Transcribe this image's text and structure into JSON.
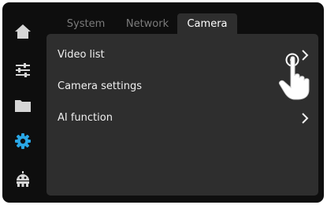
{
  "sidebar": {
    "items": [
      {
        "name": "home",
        "icon": "home-icon",
        "active": false
      },
      {
        "name": "adjustments",
        "icon": "sliders-icon",
        "active": false
      },
      {
        "name": "files",
        "icon": "folder-icon",
        "active": false
      },
      {
        "name": "settings",
        "icon": "gear-icon",
        "active": true
      },
      {
        "name": "robot",
        "icon": "robot-icon",
        "active": false
      }
    ]
  },
  "tabs": [
    {
      "label": "System",
      "active": false
    },
    {
      "label": "Network",
      "active": false
    },
    {
      "label": "Camera",
      "active": true
    }
  ],
  "menu": {
    "items": [
      {
        "label": "Video list",
        "has_chevron": true
      },
      {
        "label": "Camera settings",
        "has_chevron": false
      },
      {
        "label": "AI function",
        "has_chevron": true
      }
    ]
  },
  "colors": {
    "background": "#0e0e0e",
    "panel": "#2e2e2e",
    "icon": "#d6d6d6",
    "accent": "#2aa7e6",
    "text": "#f0f0f0",
    "tab_inactive": "#7b7b7b"
  }
}
